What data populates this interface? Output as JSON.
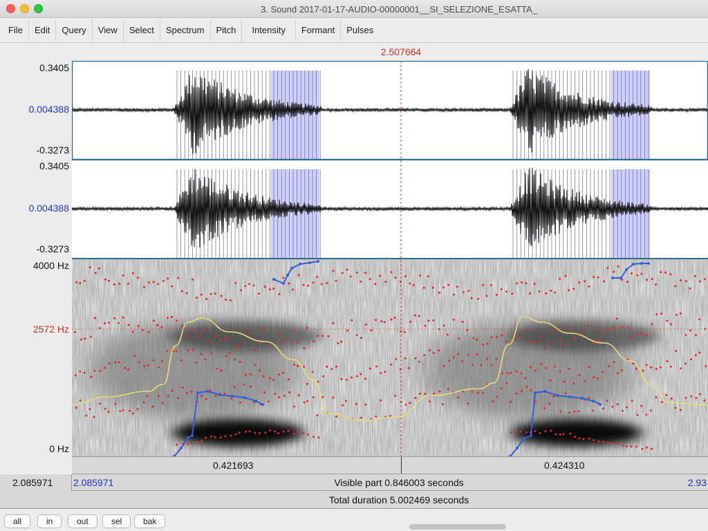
{
  "window": {
    "title": "3. Sound 2017-01-17-AUDIO-00000001__SI_SELEZIONE_ESATTA_"
  },
  "menu": [
    "File",
    "Edit",
    "Query",
    "View",
    "Select",
    "Spectrum",
    "Pitch",
    "Intensity",
    "Formant",
    "Pulses"
  ],
  "cursor": {
    "time": "2.507664"
  },
  "waveform_top": {
    "max": "0.3405",
    "center": "0.004388",
    "min": "-0.3273"
  },
  "waveform_bottom": {
    "max": "0.3405",
    "center": "0.004388",
    "min": "-0.3273"
  },
  "spectrogram": {
    "top_label": "4000 Hz",
    "cursor_label": "2572 Hz",
    "bottom_label": "0 Hz"
  },
  "time_axis": {
    "left_value": "0.421693",
    "right_value": "0.424310"
  },
  "visible": {
    "window_start": "2.085971",
    "start": "2.085971",
    "label": "Visible part 0.846003 seconds",
    "end": "2.93"
  },
  "total": {
    "label": "Total duration 5.002469 seconds"
  },
  "buttons": {
    "all": "all",
    "in": "in",
    "out": "out",
    "sel": "sel",
    "bak": "bak"
  },
  "colors": {
    "cursor": "#d03020",
    "pitch": "#2f5fd8",
    "formant": "#e02a2a",
    "intensity": "#d8d06a",
    "pulse": "#3a3a3a",
    "selection": "#c8c8ff"
  }
}
